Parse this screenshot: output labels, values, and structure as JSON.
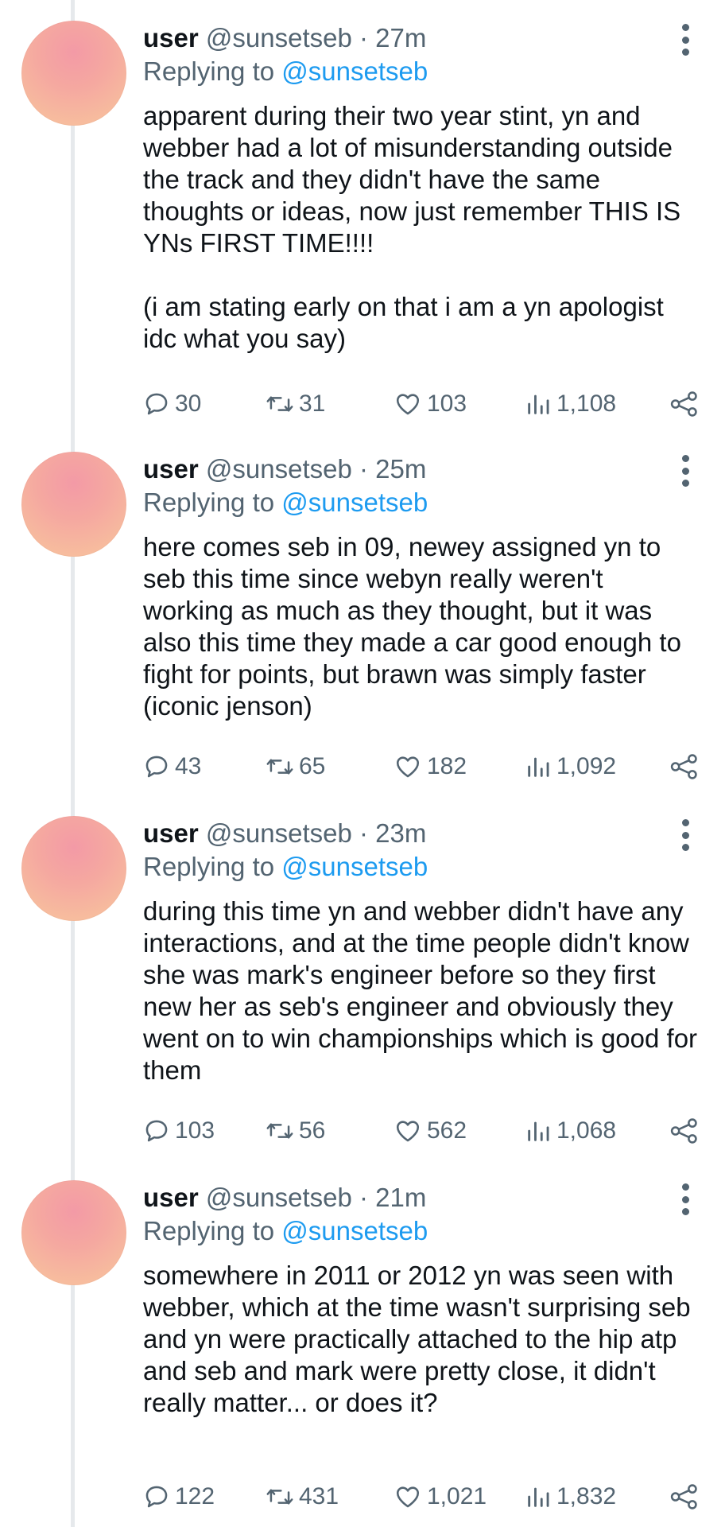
{
  "tweets": [
    {
      "name": "user",
      "handle": "@sunsetseb",
      "separator": "·",
      "time": "27m",
      "replying_prefix": "Replying to",
      "replying_to": "@sunsetseb",
      "text": "apparent during their two year stint, yn and webber had a lot of misunderstanding outside the track and they didn't have the same thoughts or ideas, now just remember THIS IS YNs FIRST TIME!!!!\n\n(i am stating early on that i am a yn apologist idc what you say)",
      "replies": "30",
      "retweets": "31",
      "likes": "103",
      "views": "1,108"
    },
    {
      "name": "user",
      "handle": "@sunsetseb",
      "separator": "·",
      "time": "25m",
      "replying_prefix": "Replying to",
      "replying_to": "@sunsetseb",
      "text": "here comes seb in 09, newey assigned yn to seb this time since webyn really weren't working as much as they thought, but it was also this time they made a car good enough to fight for points, but brawn was simply faster (iconic jenson)",
      "replies": "43",
      "retweets": "65",
      "likes": "182",
      "views": "1,092"
    },
    {
      "name": "user",
      "handle": "@sunsetseb",
      "separator": "·",
      "time": "23m",
      "replying_prefix": "Replying to",
      "replying_to": "@sunsetseb",
      "text": "during this time yn and webber didn't have any interactions, and at the time people didn't know she was mark's engineer before so they first new her as seb's engineer and obviously they went on to win championships which is good for them",
      "replies": "103",
      "retweets": "56",
      "likes": "562",
      "views": "1,068"
    },
    {
      "name": "user",
      "handle": "@sunsetseb",
      "separator": "·",
      "time": "21m",
      "replying_prefix": "Replying to",
      "replying_to": "@sunsetseb",
      "text": "somewhere in 2011 or 2012 yn was seen with webber, which at the time wasn't surprising seb and yn were practically attached to the hip atp and seb and mark were pretty close, it didn't really matter... or does it?",
      "replies": "122",
      "retweets": "431",
      "likes": "1,021",
      "views": "1,832"
    }
  ],
  "icons": {
    "reply": "reply-icon",
    "retweet": "retweet-icon",
    "like": "heart-icon",
    "views": "views-icon",
    "share": "share-icon",
    "more": "more-icon"
  },
  "colors": {
    "text": "#0f1419",
    "muted": "#536471",
    "link": "#1d9bf0",
    "thread_line": "#e6e9ec"
  }
}
